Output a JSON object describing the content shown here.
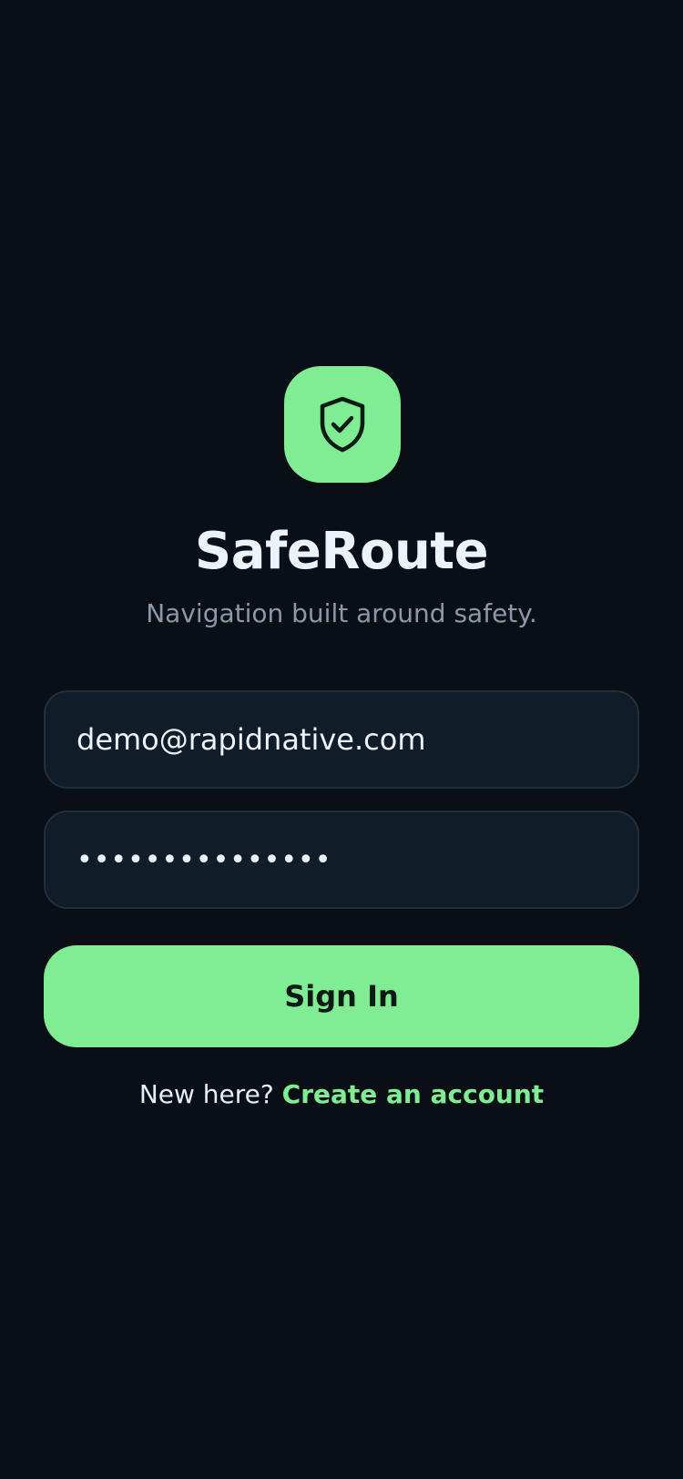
{
  "app": {
    "name": "SafeRoute",
    "tagline": "Navigation built around safety.",
    "logo_icon": "shield-check-icon"
  },
  "form": {
    "email_value": "demo@rapidnative.com",
    "password_value": "•••••••••••••••",
    "signin_label": "Sign In"
  },
  "footer": {
    "prompt": "New here?",
    "link_label": "Create an account"
  },
  "colors": {
    "background": "#0a0f16",
    "accent": "#80ec93",
    "field_bg": "#101d28",
    "field_border": "#1f2f3d",
    "muted_text": "#8a98aa"
  }
}
